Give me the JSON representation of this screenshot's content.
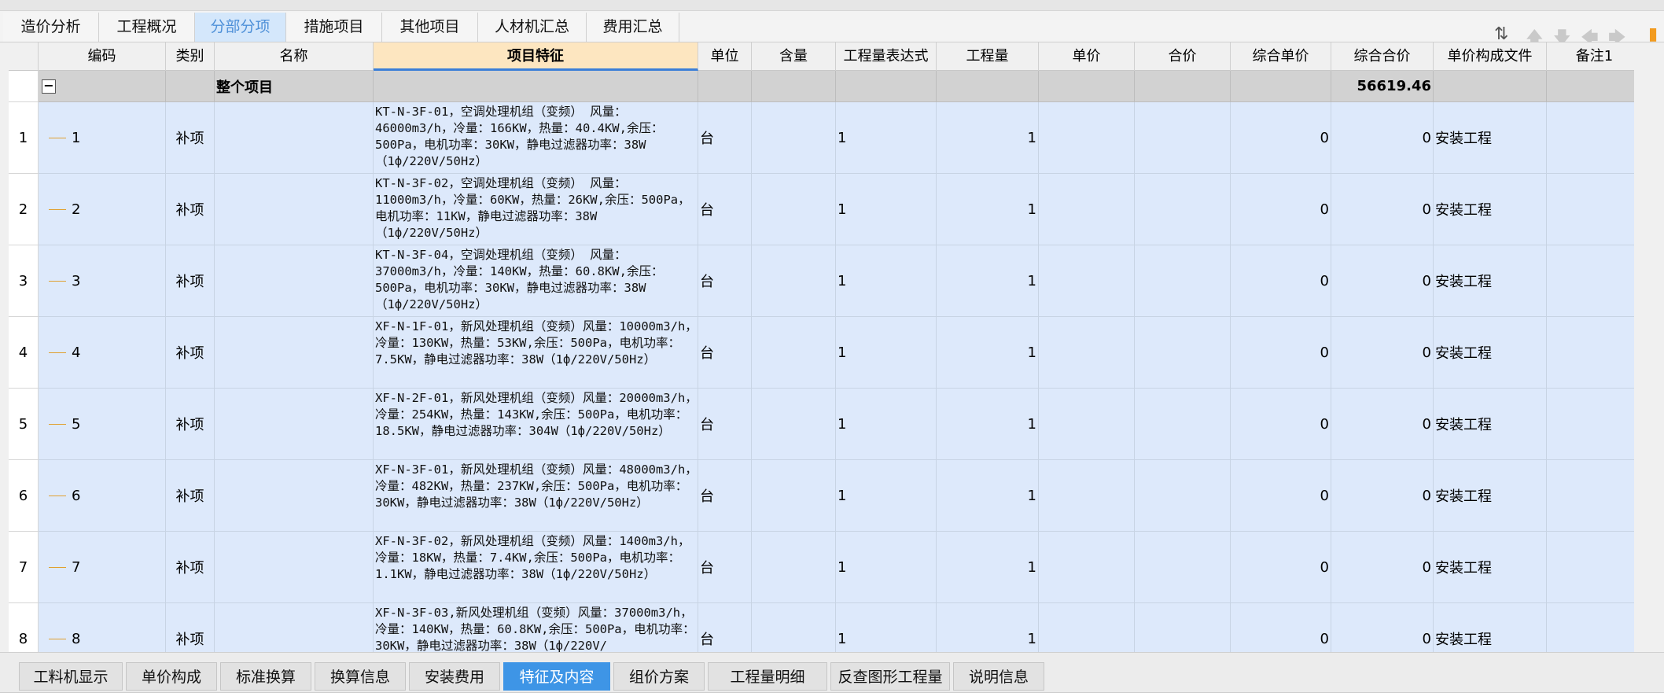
{
  "top_tabs": [
    {
      "label": "造价分析",
      "active": false
    },
    {
      "label": "工程概况",
      "active": false
    },
    {
      "label": "分部分项",
      "active": true
    },
    {
      "label": "措施项目",
      "active": false
    },
    {
      "label": "其他项目",
      "active": false
    },
    {
      "label": "人材机汇总",
      "active": false
    },
    {
      "label": "费用汇总",
      "active": false
    }
  ],
  "toolbar_icons": [
    "column-sort-icon",
    "arrow-up-icon",
    "arrow-down-icon",
    "arrow-left-icon",
    "arrow-right-icon",
    "app-settings-icon"
  ],
  "columns": [
    "",
    "编码",
    "类别",
    "名称",
    "项目特征",
    "单位",
    "含量",
    "工程量表达式",
    "工程量",
    "单价",
    "合价",
    "综合单价",
    "综合合价",
    "单价构成文件",
    "备注1"
  ],
  "summary_row": {
    "collapse": "−",
    "name": "整个项目",
    "total": "56619.46"
  },
  "rows": [
    {
      "idx": "1",
      "code": "1",
      "type": "补项",
      "feature": "KT-N-3F-01，空调处理机组（变频） 风量：46000m3/h，冷量：166KW，热量：40.4KW,余压：500Pa，电机功率：30KW，静电过滤器功率：38W（1ф/220V/50Hz）",
      "unit": "台",
      "expr": "1",
      "qty": "1",
      "comp_price": "0",
      "comp_total": "0",
      "file": "安装工程"
    },
    {
      "idx": "2",
      "code": "2",
      "type": "补项",
      "feature": "KT-N-3F-02，空调处理机组（变频） 风量：11000m3/h，冷量：60KW，热量：26KW,余压：500Pa，电机功率：11KW，静电过滤器功率：38W（1ф/220V/50Hz）",
      "unit": "台",
      "expr": "1",
      "qty": "1",
      "comp_price": "0",
      "comp_total": "0",
      "file": "安装工程"
    },
    {
      "idx": "3",
      "code": "3",
      "type": "补项",
      "feature": "KT-N-3F-04，空调处理机组（变频） 风量：37000m3/h，冷量：140KW，热量：60.8KW,余压：500Pa，电机功率：30KW，静电过滤器功率：38W（1ф/220V/50Hz）",
      "unit": "台",
      "expr": "1",
      "qty": "1",
      "comp_price": "0",
      "comp_total": "0",
      "file": "安装工程"
    },
    {
      "idx": "4",
      "code": "4",
      "type": "补项",
      "feature": "XF-N-1F-01，新风处理机组（变频）风量：10000m3/h，冷量：130KW，热量：53KW,余压：500Pa，电机功率：7.5KW，静电过滤器功率：38W（1ф/220V/50Hz）",
      "unit": "台",
      "expr": "1",
      "qty": "1",
      "comp_price": "0",
      "comp_total": "0",
      "file": "安装工程"
    },
    {
      "idx": "5",
      "code": "5",
      "type": "补项",
      "feature": "XF-N-2F-01，新风处理机组（变频）风量：20000m3/h，冷量：254KW，热量：143KW,余压：500Pa，电机功率：18.5KW，静电过滤器功率：304W（1ф/220V/50Hz）",
      "unit": "台",
      "expr": "1",
      "qty": "1",
      "comp_price": "0",
      "comp_total": "0",
      "file": "安装工程"
    },
    {
      "idx": "6",
      "code": "6",
      "type": "补项",
      "feature": "XF-N-3F-01，新风处理机组（变频）风量：48000m3/h，冷量：482KW，热量：237KW,余压：500Pa，电机功率：30KW，静电过滤器功率：38W（1ф/220V/50Hz）",
      "unit": "台",
      "expr": "1",
      "qty": "1",
      "comp_price": "0",
      "comp_total": "0",
      "file": "安装工程"
    },
    {
      "idx": "7",
      "code": "7",
      "type": "补项",
      "feature": "XF-N-3F-02，新风处理机组（变频）风量：1400m3/h，冷量：18KW，热量：7.4KW,余压：500Pa，电机功率：1.1KW，静电过滤器功率：38W（1ф/220V/50Hz）",
      "unit": "台",
      "expr": "1",
      "qty": "1",
      "comp_price": "0",
      "comp_total": "0",
      "file": "安装工程"
    },
    {
      "idx": "8",
      "code": "8",
      "type": "补项",
      "feature": "XF-N-3F-03,新风处理机组（变频）风量：37000m3/h，冷量：140KW，热量：60.8KW,余压：500Pa，电机功率：30KW，静电过滤器功率：38W（1ф/220V/",
      "unit": "台",
      "expr": "1",
      "qty": "1",
      "comp_price": "0",
      "comp_total": "0",
      "file": "安装工程"
    }
  ],
  "bottom_tabs": [
    {
      "label": "工料机显示",
      "active": false
    },
    {
      "label": "单价构成",
      "active": false
    },
    {
      "label": "标准换算",
      "active": false
    },
    {
      "label": "换算信息",
      "active": false
    },
    {
      "label": "安装费用",
      "active": false
    },
    {
      "label": "特征及内容",
      "active": true
    },
    {
      "label": "组价方案",
      "active": false
    },
    {
      "label": "工程量明细",
      "active": false
    },
    {
      "label": "反查图形工程量",
      "active": false
    },
    {
      "label": "说明信息",
      "active": false
    }
  ],
  "colors": {
    "accent": "#3e95e6",
    "row_bg": "#dde9fb",
    "feature_header": "#fde6c0",
    "summary_bg": "#d2d2d2"
  }
}
